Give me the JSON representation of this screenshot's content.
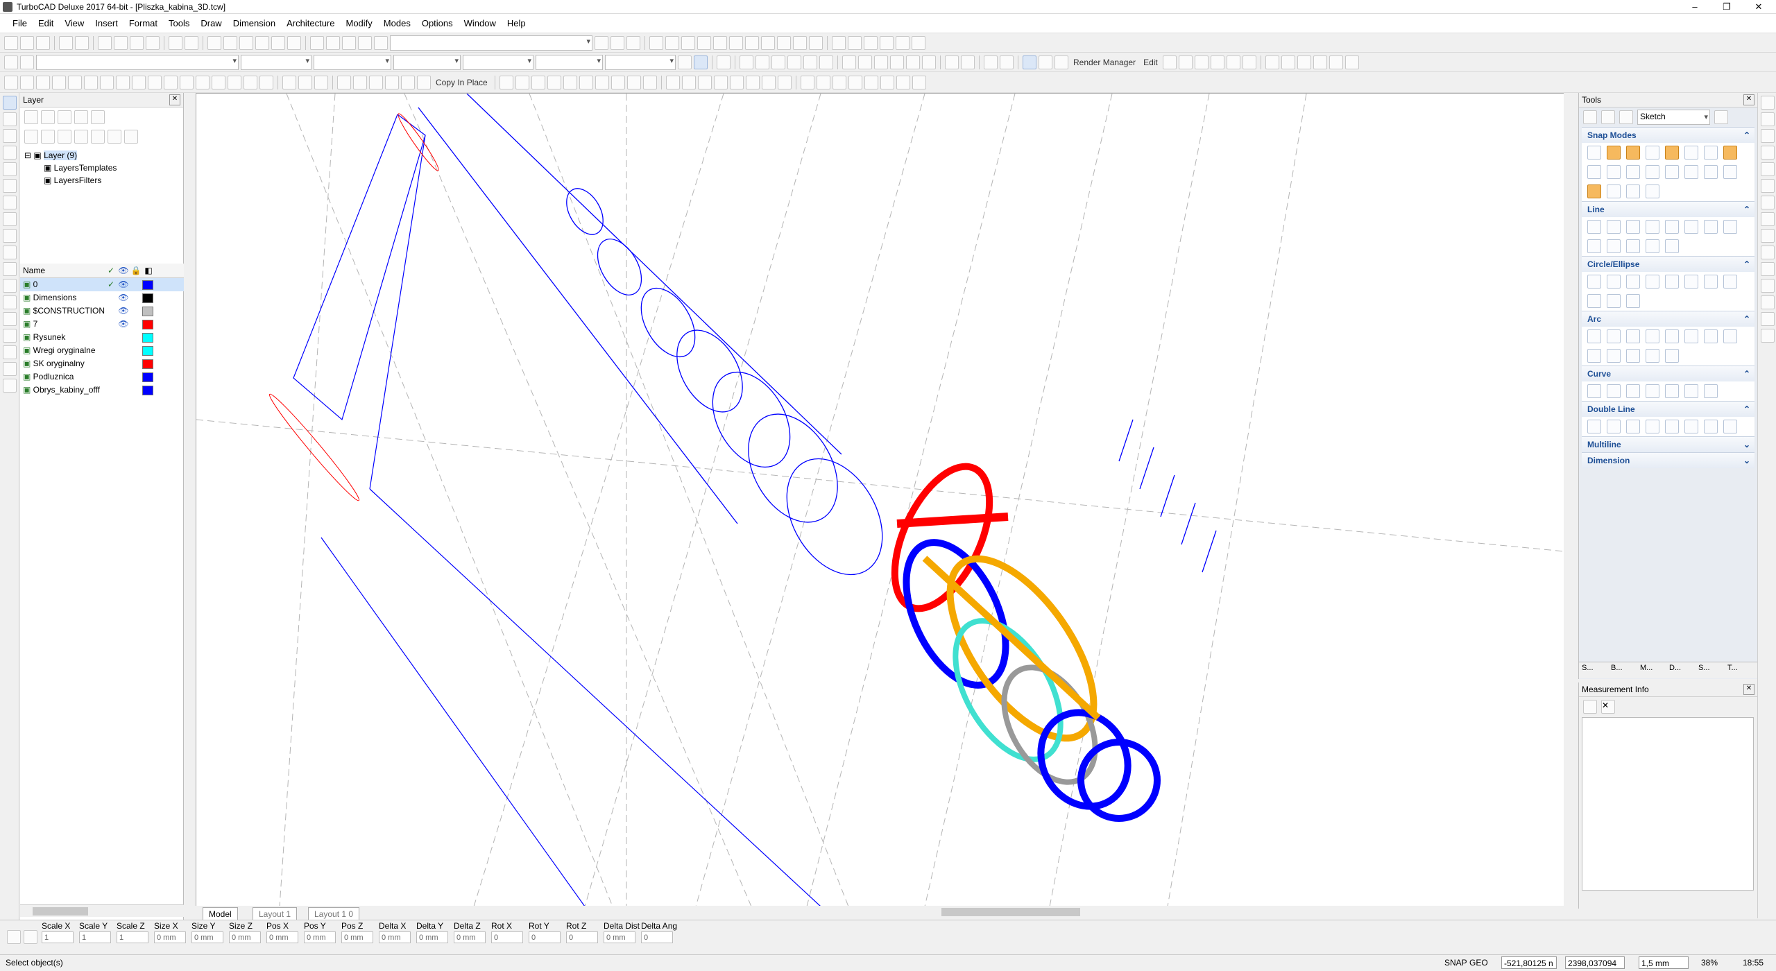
{
  "window": {
    "title": "TurboCAD Deluxe 2017 64-bit - [Pliszka_kabina_3D.tcw]",
    "min_glyph": "–",
    "max_glyph": "❐",
    "close_glyph": "✕"
  },
  "menu": [
    "File",
    "Edit",
    "View",
    "Insert",
    "Format",
    "Tools",
    "Draw",
    "Dimension",
    "Architecture",
    "Modify",
    "Modes",
    "Options",
    "Window",
    "Help"
  ],
  "toolbar": {
    "render_manager": "Render Manager",
    "edit": "Edit",
    "copy_in_place": "Copy In Place"
  },
  "layer_panel": {
    "title": "Layer",
    "tree": {
      "root": "Layer (9)",
      "child1": "LayersTemplates",
      "child2": "LayersFilters"
    },
    "table_header": "Name",
    "rows": [
      {
        "name": "0",
        "current": true,
        "visible": true,
        "color": "#0000ff"
      },
      {
        "name": "Dimensions",
        "current": false,
        "visible": true,
        "color": "#000000"
      },
      {
        "name": "$CONSTRUCTION",
        "current": false,
        "visible": true,
        "color": "#c0c0c0"
      },
      {
        "name": "7",
        "current": false,
        "visible": true,
        "color": "#ff0000"
      },
      {
        "name": "Rysunek",
        "current": false,
        "visible": false,
        "color": "#00ffff"
      },
      {
        "name": "Wregi oryginalne",
        "current": false,
        "visible": false,
        "color": "#00ffff"
      },
      {
        "name": "SK oryginalny",
        "current": false,
        "visible": false,
        "color": "#ff0000"
      },
      {
        "name": "Podluznica",
        "current": false,
        "visible": false,
        "color": "#0000ff"
      },
      {
        "name": "Obrys_kabiny_offf",
        "current": false,
        "visible": false,
        "color": "#0000ff"
      }
    ]
  },
  "tabs": {
    "model": "Model",
    "layout1": "Layout 1",
    "layout10": "Layout 1 0"
  },
  "tools_panel": {
    "title": "Tools",
    "sketch": "Sketch",
    "sections": [
      "Snap Modes",
      "Line",
      "Circle/Ellipse",
      "Arc",
      "Curve",
      "Double Line",
      "Multiline",
      "Dimension"
    ],
    "bottom_tabs": [
      "S...",
      "B...",
      "M...",
      "D...",
      "S...",
      "T..."
    ]
  },
  "measure": {
    "title": "Measurement Info"
  },
  "inspector": {
    "labels": [
      "Scale X",
      "Scale Y",
      "Scale Z",
      "Size X",
      "Size Y",
      "Size Z",
      "Pos X",
      "Pos Y",
      "Pos Z",
      "Delta X",
      "Delta Y",
      "Delta Z",
      "Rot X",
      "Rot Y",
      "Rot Z",
      "Delta Dist",
      "Delta Ang"
    ],
    "values": [
      "1",
      "1",
      "1",
      "0 mm",
      "0 mm",
      "0 mm",
      "0 mm",
      "0 mm",
      "0 mm",
      "0 mm",
      "0 mm",
      "0 mm",
      "0",
      "0",
      "0",
      "0 mm",
      "0"
    ]
  },
  "status": {
    "message": "Select object(s)",
    "snap": "SNAP",
    "geo": "GEO",
    "coord_x": "-521,80125 n",
    "coord_y": "2398,037094",
    "step": "1,5 mm",
    "zoom": "38%",
    "time": "18:55"
  },
  "colors": {
    "red": "#ff0000",
    "blue": "#0000ff",
    "orange": "#f5a800",
    "cyan": "#40e0d0",
    "gray": "#999999"
  }
}
